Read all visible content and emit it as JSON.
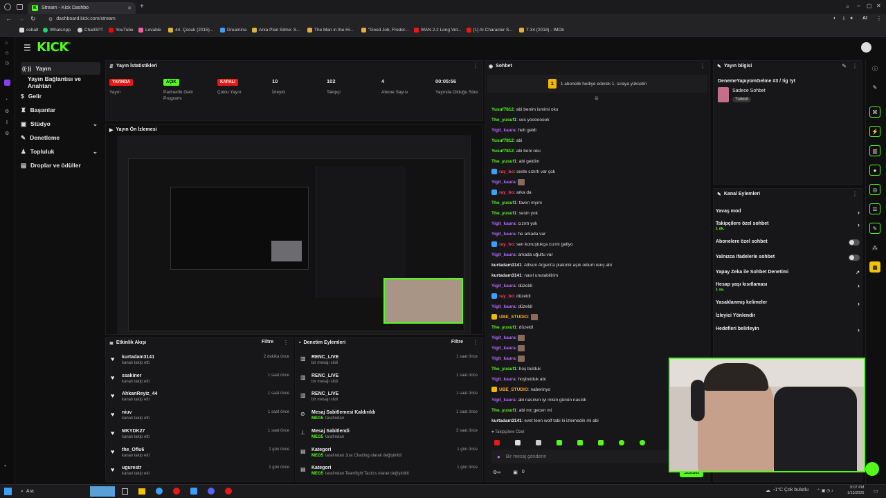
{
  "browser": {
    "tab_title": "Stream - Kick Dashbo",
    "url": "dashboard.kick.com/stream",
    "bookmarks": [
      "cobalt",
      "WhatsApp",
      "ChatGPT",
      "YouTube",
      "Lovable",
      "44. Çocuk (2015)...",
      "Dreamina",
      "Arka Plan Silme: S...",
      "The Man in the Hi...",
      "\"Good Job, Freder...",
      "WAN 2.2 Long Vid...",
      "[1] AI Character S...",
      "T-34 (2018) - IMDb"
    ],
    "ai_label": "AI"
  },
  "app": {
    "logo": "KICK",
    "logo_sup": "beta",
    "nav": [
      {
        "label": "Yayın",
        "active": true
      },
      {
        "label": "Yayın Bağlantısı ve Anahtarı",
        "active": false
      },
      {
        "label": "Gelir",
        "active": false
      },
      {
        "label": "Başarılar",
        "active": false
      },
      {
        "label": "Stüdyo",
        "active": false,
        "expand": true
      },
      {
        "label": "Denetleme",
        "active": false
      },
      {
        "label": "Topluluk",
        "active": false,
        "expand": true
      },
      {
        "label": "Droplar ve ödüller",
        "active": false
      }
    ]
  },
  "stats": {
    "title": "Yayın İstatistikleri",
    "items": [
      {
        "badge": "YAYINDA",
        "badge_color": "#e91916",
        "label": "Yayın"
      },
      {
        "badge": "AÇIK",
        "badge_color": "#53fc18",
        "label": "Partnerlik Gelir Programı"
      },
      {
        "badge": "KAPALI",
        "badge_color": "#e91916",
        "label": "Çoklu Yayın"
      },
      {
        "value": "10",
        "label": "İzleyici"
      },
      {
        "value": "102",
        "label": "Takipçi"
      },
      {
        "value": "4",
        "label": "Abone Sayısı"
      },
      {
        "value": "00:05:56",
        "label": "Yayında Olduğu Süre"
      }
    ]
  },
  "preview": {
    "title": "Yayın Ön İzlemesi"
  },
  "activity": {
    "title": "Etkinlik Akışı",
    "filter": "Filtre",
    "rows": [
      {
        "name": "kurtadam3141",
        "sub": "kanalı takip etti",
        "time": "2 dakika önce"
      },
      {
        "name": "ssakiner",
        "sub": "kanalı takip etti",
        "time": "1 saat önce"
      },
      {
        "name": "AhkanReyiz_44",
        "sub": "kanalı takip etti",
        "time": "1 saat önce"
      },
      {
        "name": "niuv",
        "sub": "kanalı takip etti",
        "time": "1 saat önce"
      },
      {
        "name": "MKYDK27",
        "sub": "kanalı takip etti",
        "time": "1 saat önce"
      },
      {
        "name": "the_Oflu6",
        "sub": "kanalı takip etti",
        "time": "1 gün önce"
      },
      {
        "name": "ugurestr",
        "sub": "kanalı takip etti",
        "time": "1 gün önce"
      }
    ]
  },
  "moderation": {
    "title": "Denetim Eylemleri",
    "filter": "Filtre",
    "rows": [
      {
        "icon": "trash-icon",
        "name": "RENC_LIVE",
        "sub": "bir mesajı sildi",
        "time": "1 saat önce"
      },
      {
        "icon": "trash-icon",
        "name": "RENC_LIVE",
        "sub": "bir mesajı sildi",
        "time": "1 saat önce"
      },
      {
        "icon": "trash-icon",
        "name": "RENC_LIVE",
        "sub": "bir mesajı sildi",
        "time": "1 saat önce"
      },
      {
        "icon": "unpin-icon",
        "name": "Mesaj Sabitlemesi Kaldırıldı",
        "sub_user": "MEG5",
        "sub": "tarafından",
        "time": "1 saat önce"
      },
      {
        "icon": "pin-icon",
        "name": "Mesaj Sabitlendi",
        "sub_user": "MEG5",
        "sub": "tarafından",
        "time": "3 saat önce"
      },
      {
        "icon": "category-icon",
        "name": "Kategori",
        "sub_user": "MEG5",
        "sub": "tarafından Just Chatting olarak değiştirildi",
        "time": "1 gün önce"
      },
      {
        "icon": "category-icon",
        "name": "Kategori",
        "sub_user": "MEG5",
        "sub": "tarafından Teamfight Tactics olarak değiştirildi",
        "time": "1 gün önce"
      }
    ]
  },
  "chat": {
    "title": "Sohbet",
    "banner": "1 abonelik hediye ederek 1. sıraya yükselin",
    "messages": [
      {
        "user": "Yusuf7812",
        "color": "u-green",
        "text": "abi benim ismimi oku"
      },
      {
        "user": "The_yusuf1",
        "color": "u-green",
        "text": "ses yoooooook"
      },
      {
        "user": "Yigit_kaura",
        "color": "u-purple",
        "text": "heh geldi"
      },
      {
        "user": "Yusuf7812",
        "color": "u-green",
        "text": "abi"
      },
      {
        "user": "Yusuf7812",
        "color": "u-green",
        "text": "abi beni oku"
      },
      {
        "user": "The_yusuf1",
        "color": "u-green",
        "text": "abi geldim"
      },
      {
        "user": "ray_bo",
        "color": "u-red",
        "text": "seste cızırtı var çok",
        "badge": true
      },
      {
        "user": "Yigit_kaura",
        "color": "u-purple",
        "text": ""
      },
      {
        "user": "ray_bo",
        "color": "u-red",
        "text": "arka da",
        "badge": true
      },
      {
        "user": "The_yusuf1",
        "color": "u-green",
        "text": "fawın myım"
      },
      {
        "user": "The_yusuf1",
        "color": "u-green",
        "text": "sesin yok"
      },
      {
        "user": "Yigit_kaura",
        "color": "u-purple",
        "text": "cızırtı yok"
      },
      {
        "user": "Yigit_kaura",
        "color": "u-purple",
        "text": "he arkada var"
      },
      {
        "user": "ray_bo",
        "color": "u-red",
        "text": "sen konuştukça cızırtı geliyo",
        "badge": true
      },
      {
        "user": "Yigit_kaura",
        "color": "u-purple",
        "text": "arkada uğultu var"
      },
      {
        "user": "kurtadam3141",
        "color": "u-white",
        "text": "Allison Argent'a platonik aşık oldum renç abi"
      },
      {
        "user": "kurtadam3141",
        "color": "u-white",
        "text": "nasıl unutabilirim"
      },
      {
        "user": "Yigit_kaura",
        "color": "u-purple",
        "text": "düzeldi"
      },
      {
        "user": "ray_bo",
        "color": "u-red",
        "text": "düzeldi",
        "badge": true
      },
      {
        "user": "Yigit_kaura",
        "color": "u-purple",
        "text": "düzeldi"
      },
      {
        "user": "UBE_STUDIO",
        "color": "u-orange",
        "text": "",
        "badge": true
      },
      {
        "user": "The_yusuf1",
        "color": "u-green",
        "text": "düzeldi"
      },
      {
        "user": "Yigit_kaura",
        "color": "u-purple",
        "text": ""
      },
      {
        "user": "Yigit_kaura",
        "color": "u-purple",
        "text": ""
      },
      {
        "user": "Yigit_kaura",
        "color": "u-purple",
        "text": ""
      },
      {
        "user": "The_yusuf1",
        "color": "u-green",
        "text": "hoş bulduk"
      },
      {
        "user": "Yigit_kaura",
        "color": "u-purple",
        "text": "hoşbulduk abi"
      },
      {
        "user": "UBE_STUDIO",
        "color": "u-orange",
        "text": "naberinyo",
        "badge": true
      },
      {
        "user": "Yigit_kaura",
        "color": "u-purple",
        "text": "abi nasılsın iyi misin günün nasıldı"
      },
      {
        "user": "The_yusuf1",
        "color": "u-green",
        "text": "abi mc gecen mi"
      },
      {
        "user": "kurtadam3141",
        "color": "u-white",
        "text": "evet teen wolf tabi ki izlemedin mi abi"
      }
    ],
    "followers_only": "Takipçilere Özel",
    "input_placeholder": "Bir mesaj gönderin",
    "send": "Sohbet",
    "count": "0"
  },
  "stream_info": {
    "title": "Yayın bilgisi",
    "stream_title": "DenemeYapıyomGelme #3 / !ig !yt",
    "category": "Sadece Sohbet",
    "language": "Turkish"
  },
  "channel_actions": {
    "title": "Kanal Eylemleri",
    "rows": [
      {
        "label": "Yavaş mod",
        "kind": "chevron"
      },
      {
        "label": "Takipçilere özel sohbet",
        "sub": "1 dk.",
        "kind": "chevron"
      },
      {
        "label": "Abonelere özel sohbet",
        "kind": "toggle"
      },
      {
        "label": "Yalnızca ifadelerle sohbet",
        "kind": "toggle"
      },
      {
        "label": "Yapay Zeka ile Sohbet Denetimi",
        "kind": "external"
      },
      {
        "label": "Hesap yaşı kısıtlaması",
        "sub": "1 sa.",
        "kind": "chevron"
      },
      {
        "label": "Yasaklanmış kelimeler",
        "kind": "chevron"
      },
      {
        "label": "İzleyici Yönlendir",
        "kind": "none"
      },
      {
        "label": "Hedefleri belirleyin",
        "kind": "chevron"
      }
    ]
  },
  "taskbar": {
    "search": "Ara",
    "weather": "-1°C  Çok bulutlu",
    "time": "9:07 PM",
    "date": "1/13/2026"
  },
  "colors": {
    "accent": "#53fc18",
    "live": "#e91916"
  }
}
